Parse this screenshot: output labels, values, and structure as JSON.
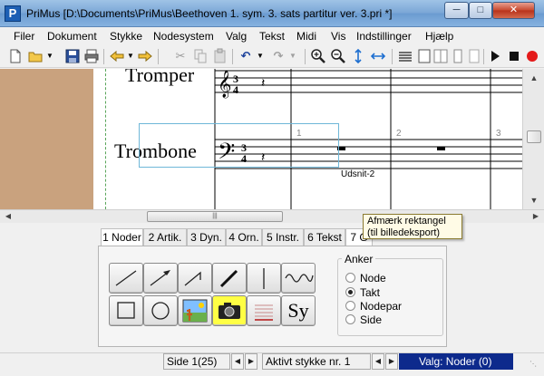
{
  "window": {
    "title": "PriMus [D:\\Documents\\PriMus\\Beethoven 1. sym. 3. sats partitur ver. 3.pri *]",
    "icon_letter": "P"
  },
  "menu": [
    "Filer",
    "Dokument",
    "Stykke",
    "Nodesystem",
    "Valg",
    "Tekst",
    "Midi",
    "Vis",
    "Indstillinger",
    "Hjælp"
  ],
  "score": {
    "staves": [
      {
        "name": "Tromper",
        "clef": "treble",
        "time": "3/4"
      },
      {
        "name": "Trombone",
        "clef": "bass",
        "time": "3/4"
      }
    ],
    "measure_numbers": [
      "1",
      "2",
      "3"
    ],
    "selection_label": "Udsnit-2"
  },
  "tooltip": {
    "line1": "Afmærk rektangel",
    "line2": "(til billedeksport)"
  },
  "tabs": [
    "1 Noder",
    "2 Artik.",
    "3 Dyn.",
    "4 Orn.",
    "5 Instr.",
    "6 Tekst",
    "7 G"
  ],
  "tools": [
    {
      "name": "line-tool",
      "icon": "line"
    },
    {
      "name": "arrow-tool",
      "icon": "arrow"
    },
    {
      "name": "angled-line-tool",
      "icon": "angled-line"
    },
    {
      "name": "thick-line-tool",
      "icon": "thick-line"
    },
    {
      "name": "vertical-line-tool",
      "icon": "vertical-line"
    },
    {
      "name": "wave-tool",
      "icon": "wave"
    },
    {
      "name": "rectangle-tool",
      "icon": "rectangle"
    },
    {
      "name": "circle-tool",
      "icon": "circle"
    },
    {
      "name": "image-tool",
      "icon": "landscape-picture"
    },
    {
      "name": "camera-tool",
      "icon": "camera"
    },
    {
      "name": "staff-lines-tool",
      "icon": "staff-lines"
    },
    {
      "name": "symbol-tool",
      "icon": "symbol",
      "label": "Sy"
    }
  ],
  "anker": {
    "title": "Anker",
    "options": [
      "Node",
      "Takt",
      "Nodepar",
      "Side"
    ],
    "selected": "Takt"
  },
  "status": {
    "page": "Side 1(25)",
    "active_piece": "Aktivt stykke nr. 1",
    "selection": "Valg: Noder (0)"
  },
  "colors": {
    "margin": "#c9a27e",
    "selection_rect": "#6fb7d8",
    "status_selection_bg": "#0d2a8c",
    "highlight_tool": "#ffff44"
  }
}
